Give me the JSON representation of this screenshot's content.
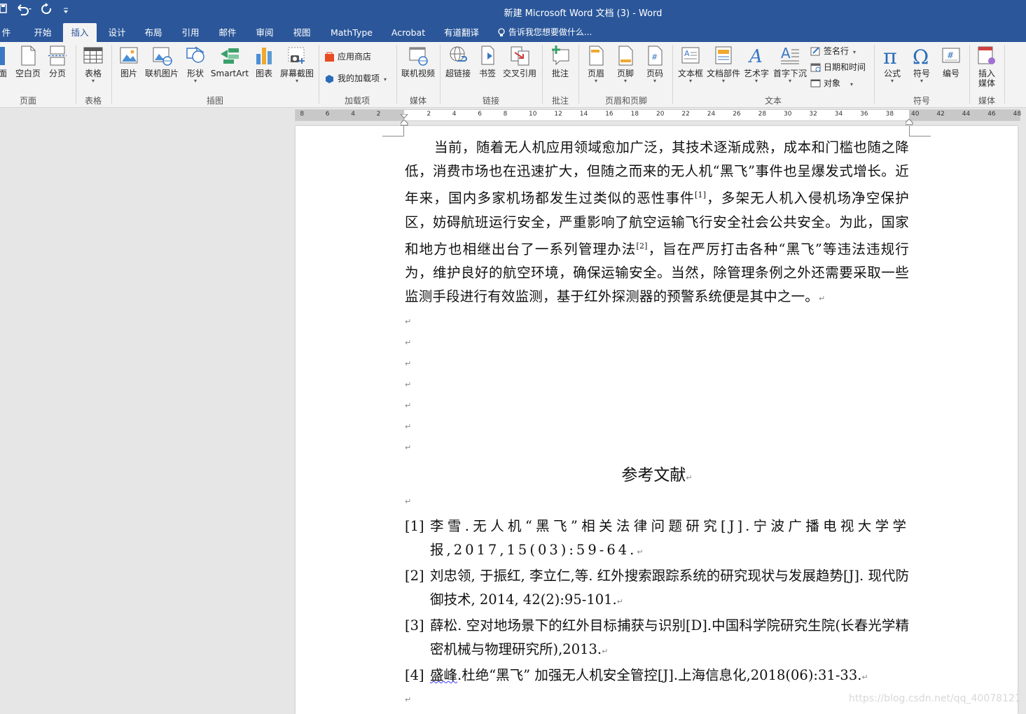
{
  "window": {
    "title": "新建 Microsoft Word 文档 (3) - Word",
    "quick_access": {
      "save_icon": "save-icon",
      "undo_icon": "undo-icon",
      "redo_icon": "redo-icon",
      "customize_icon": "customize-icon"
    }
  },
  "tabs": [
    {
      "label": "件"
    },
    {
      "label": "开始"
    },
    {
      "label": "插入",
      "active": true
    },
    {
      "label": "设计"
    },
    {
      "label": "布局"
    },
    {
      "label": "引用"
    },
    {
      "label": "邮件"
    },
    {
      "label": "审阅"
    },
    {
      "label": "视图"
    },
    {
      "label": "MathType"
    },
    {
      "label": "Acrobat"
    },
    {
      "label": "有道翻译"
    }
  ],
  "tell_me": "告诉我您想要做什么...",
  "ribbon": {
    "pages": {
      "cover_label": "面",
      "blank": "空白页",
      "break": "分页",
      "group": "页面"
    },
    "tables": {
      "table": "表格",
      "group": "表格"
    },
    "illustrations": {
      "picture": "图片",
      "online_picture": "联机图片",
      "shapes": "形状",
      "smartart": "SmartArt",
      "chart": "图表",
      "screenshot": "屏幕截图",
      "group": "插图"
    },
    "addins": {
      "store": "应用商店",
      "my_addins": "我的加载项",
      "group": "加载项"
    },
    "media": {
      "online_video": "联机视频",
      "group": "媒体"
    },
    "links": {
      "hyperlink": "超链接",
      "bookmark": "书签",
      "cross_ref": "交叉引用",
      "group": "链接"
    },
    "comments": {
      "comment": "批注",
      "group": "批注"
    },
    "header_footer": {
      "header": "页眉",
      "footer": "页脚",
      "page_number": "页码",
      "group": "页眉和页脚"
    },
    "text": {
      "textbox": "文本框",
      "quick_parts": "文档部件",
      "wordart": "艺术字",
      "dropcap": "首字下沉",
      "signature": "签名行",
      "datetime": "日期和时间",
      "object": "对象",
      "group": "文本"
    },
    "symbols": {
      "equation": "公式",
      "symbol": "符号",
      "number": "编号",
      "group": "符号"
    },
    "media2": {
      "insert_media": "插入",
      "insert_media2": "媒体",
      "group": "媒体"
    }
  },
  "ruler": {
    "left_numbers": [
      "8",
      "6",
      "4",
      "2"
    ],
    "right_numbers": [
      "2",
      "4",
      "6",
      "8",
      "10",
      "12",
      "14",
      "16",
      "18",
      "20",
      "22",
      "24",
      "26",
      "28",
      "30",
      "32",
      "34",
      "36",
      "38",
      "40",
      "42",
      "44",
      "46",
      "48"
    ]
  },
  "document": {
    "paragraph": {
      "part1": "当前，随着无人机应用领域愈加广泛，其技术逐渐成熟，成本和门槛也随之降低，消费市场也在迅速扩大，但随之而来的无人机“黑飞”事件也呈爆发式增长。近年来，国内多家机场都发生过类似的恶性事件",
      "ref1": "[1]",
      "part2": "，多架无人机入侵机场净空保护区，妨碍航班运行安全，严重影响了航空运输飞行安全社会公共安全。为此，国家和地方也相继出台了一系列管理办法",
      "ref2": "[2]",
      "part3": "，旨在严厉打击各种“黑飞”等违法违规行为，维护良好的航空环境，确保运输安全。当然，除管理条例之外还需要采取一些监测手段进行有效监测，基于红外探测器的预警系统便是其中之一。"
    },
    "paragraph_mark": "↵",
    "references_title": "参考文献",
    "references": [
      {
        "num": "[1]",
        "text": "李雪.无人机“黑飞”相关法律问题研究[J].宁波广播电视大学学报,2017,15(03):59-64."
      },
      {
        "num": "[2]",
        "text": "刘忠领, 于振红, 李立仁,等. 红外搜索跟踪系统的研究现状与发展趋势[J]. 现代防御技术, 2014, 42(2):95-101."
      },
      {
        "num": "[3]",
        "text": "薛松. 空对地场景下的红外目标捕获与识别[D].中国科学院研究生院(长春光学精密机械与物理研究所),2013."
      },
      {
        "num": "[4]",
        "author": "盛峰",
        "text": ".杜绝“黑飞” 加强无人机安全管控[J].上海信息化,2018(06):31-33."
      }
    ]
  },
  "watermark": "https://blog.csdn.net/qq_40078121"
}
